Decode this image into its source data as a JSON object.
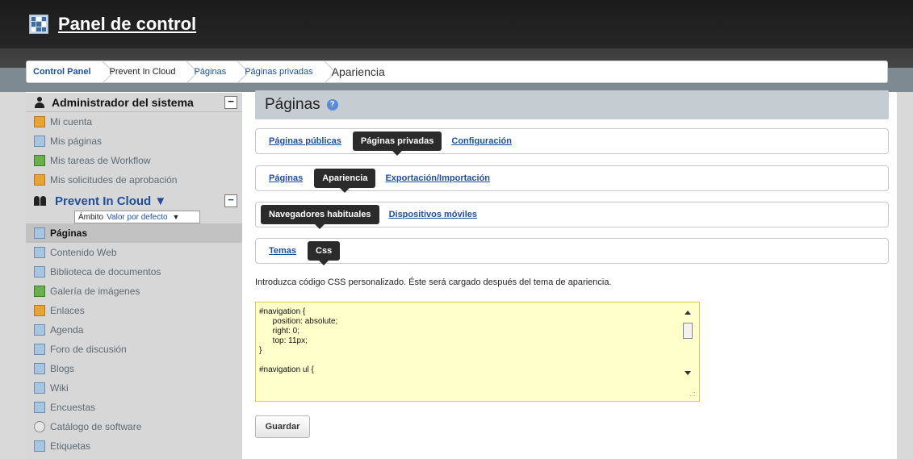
{
  "header": {
    "title": "Panel de control",
    "logo_icon": "control-panel-logo-icon"
  },
  "breadcrumb": {
    "items": [
      "Control Panel",
      "Prevent In Cloud",
      "Páginas",
      "Páginas privadas",
      "Apariencia"
    ]
  },
  "sidebar": {
    "admin_title": "Administrador del sistema",
    "collapse_label": "−",
    "admin_items": [
      {
        "label": "Mi cuenta",
        "icon": "account-icon"
      },
      {
        "label": "Mis páginas",
        "icon": "pages-icon"
      },
      {
        "label": "Mis tareas de Workflow",
        "icon": "workflow-icon"
      },
      {
        "label": "Mis solicitudes de aprobación",
        "icon": "approval-icon"
      }
    ],
    "site_title": "Prevent In Cloud ▼",
    "scope_label": "Ámbito",
    "scope_value": "Valor por defecto",
    "scope_arrow": "▼",
    "site_items": [
      {
        "label": "Páginas",
        "icon": "pages-icon"
      },
      {
        "label": "Contenido Web",
        "icon": "web-content-icon"
      },
      {
        "label": "Biblioteca de documentos",
        "icon": "documents-icon"
      },
      {
        "label": "Galería de imágenes",
        "icon": "image-gallery-icon"
      },
      {
        "label": "Enlaces",
        "icon": "links-icon"
      },
      {
        "label": "Agenda",
        "icon": "calendar-icon"
      },
      {
        "label": "Foro de discusión",
        "icon": "forum-icon"
      },
      {
        "label": "Blogs",
        "icon": "blogs-icon"
      },
      {
        "label": "Wiki",
        "icon": "wiki-icon"
      },
      {
        "label": "Encuestas",
        "icon": "polls-icon"
      },
      {
        "label": "Catálogo de software",
        "icon": "software-catalog-icon"
      },
      {
        "label": "Etiquetas",
        "icon": "tags-icon"
      }
    ]
  },
  "main": {
    "title": "Páginas",
    "help_icon": "help-icon",
    "tabs1": [
      "Páginas públicas",
      "Páginas privadas",
      "Configuración"
    ],
    "tabs2": [
      "Páginas",
      "Apariencia",
      "Exportación/Importación"
    ],
    "tabs3": [
      "Navegadores habituales",
      "Dispositivos móviles"
    ],
    "tabs4": [
      "Temas",
      "Css"
    ],
    "hint": "Introduzca código CSS personalizado. Éste será cargado después del tema de apariencia.",
    "css_code": "#navigation {\n      position: absolute;\n      right: 0;\n      top: 11px;\n}\n\n#navigation ul {",
    "save_label": "Guardar"
  },
  "colors": {
    "accent": "#1f4f9c",
    "header_bg": "#262626",
    "editor_bg": "#ffffcc"
  }
}
